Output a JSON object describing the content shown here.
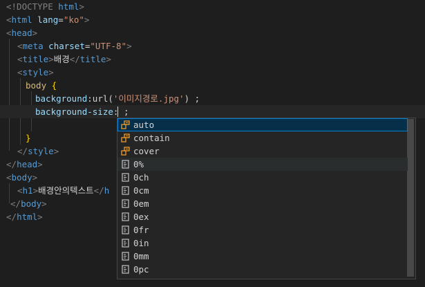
{
  "code": {
    "l1": {
      "a": "<!DOCTYPE ",
      "b": "html",
      "c": ">"
    },
    "l2": {
      "a": "<",
      "b": "html",
      "c": " lang",
      "d": "=",
      "e": "\"ko\"",
      "f": ">"
    },
    "l3": {
      "a": "<",
      "b": "head",
      "c": ">"
    },
    "l4": {
      "a": "<",
      "b": "meta",
      "c": " charset",
      "d": "=",
      "e": "\"UTF-8\"",
      "f": ">"
    },
    "l5": {
      "a": "<",
      "b": "title",
      "c": ">",
      "d": "배경",
      "e": "</",
      "f": "title",
      "g": ">"
    },
    "l6": {
      "a": "<",
      "b": "style",
      "c": ">"
    },
    "l7": {
      "a": "body",
      "b": " {"
    },
    "l8": {
      "a": "background",
      "b": ":url(",
      "c": "'이미지경로.jpg'",
      "d": ") ;"
    },
    "l9": {
      "a": "background-size",
      "b": ": ;"
    },
    "l11": {
      "a": "}"
    },
    "l12": {
      "a": "</",
      "b": "style",
      "c": ">"
    },
    "l13": {
      "a": "</",
      "b": "head",
      "c": ">"
    },
    "l14": {
      "a": "<",
      "b": "body",
      "c": ">"
    },
    "l15": {
      "a": "<",
      "b": "h1",
      "c": ">",
      "d": "배경안의텍스트",
      "e": "</",
      "f": "h"
    },
    "l16": {
      "a": "</",
      "b": "body",
      "c": ">"
    },
    "l17": {
      "a": "</",
      "b": "html",
      "c": ">"
    }
  },
  "suggest": {
    "items": [
      {
        "label": "auto",
        "icon": "value-enum-icon"
      },
      {
        "label": "contain",
        "icon": "value-enum-icon"
      },
      {
        "label": "cover",
        "icon": "value-enum-icon"
      },
      {
        "label": "0%",
        "icon": "unit-icon"
      },
      {
        "label": "0ch",
        "icon": "unit-icon"
      },
      {
        "label": "0cm",
        "icon": "unit-icon"
      },
      {
        "label": "0em",
        "icon": "unit-icon"
      },
      {
        "label": "0ex",
        "icon": "unit-icon"
      },
      {
        "label": "0fr",
        "icon": "unit-icon"
      },
      {
        "label": "0in",
        "icon": "unit-icon"
      },
      {
        "label": "0mm",
        "icon": "unit-icon"
      },
      {
        "label": "0pc",
        "icon": "unit-icon"
      }
    ],
    "selected_index": 0,
    "hover_index": 3
  },
  "colors": {
    "background": "#1e1e1e",
    "tag": "#569cd6",
    "attribute": "#9cdcfe",
    "string": "#ce9178",
    "selector": "#d7ba7d",
    "enum_icon": "#ee9d28",
    "selection": "#062f4a",
    "focus_border": "#007fd4"
  }
}
